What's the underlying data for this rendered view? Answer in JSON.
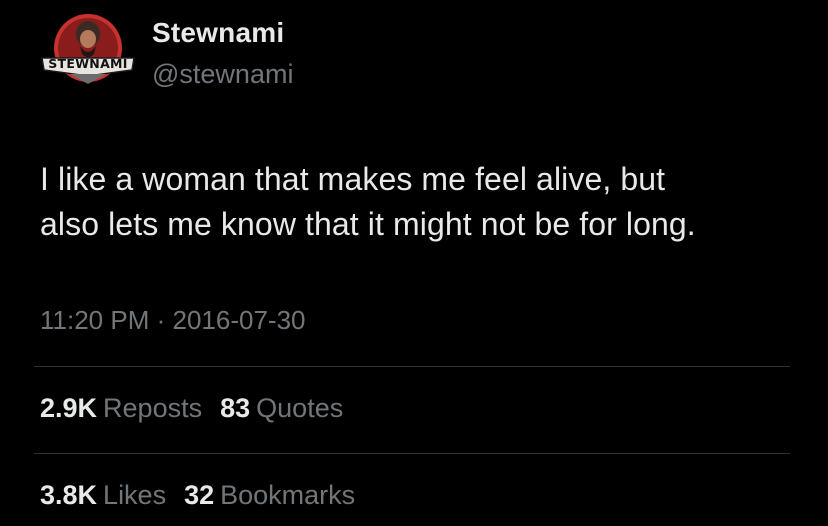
{
  "author": {
    "display_name": "Stewnami",
    "handle": "@stewnami",
    "avatar_logo_text": "STEWNAMI"
  },
  "tweet": {
    "text_lines": [
      "I like a woman that makes me feel alive, but",
      "also lets me know that it might not be for long."
    ],
    "time": "11:20 PM",
    "separator": "·",
    "date": "2016-07-30"
  },
  "stats": {
    "reposts": {
      "count": "2.9K",
      "label": "Reposts"
    },
    "quotes": {
      "count": "83",
      "label": "Quotes"
    },
    "likes": {
      "count": "3.8K",
      "label": "Likes"
    },
    "bookmarks": {
      "count": "32",
      "label": "Bookmarks"
    }
  },
  "colors": {
    "background": "#000000",
    "primary_text": "#e7e9ea",
    "secondary_text": "#71767b",
    "divider": "#2f3336",
    "avatar_red": "#c8322e"
  }
}
